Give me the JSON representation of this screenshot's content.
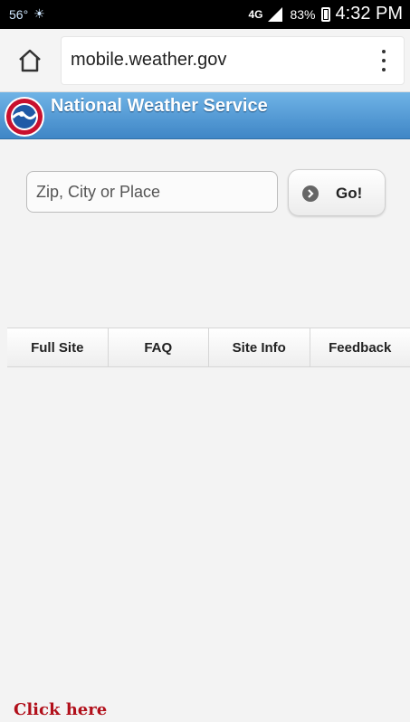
{
  "status_bar": {
    "temperature": "56°",
    "weather_glyph": "weather-sun-icon",
    "network": "4G",
    "battery": "83%",
    "time": "4:32 PM"
  },
  "browser": {
    "url": "mobile.weather.gov"
  },
  "nws": {
    "title": "National Weather Service",
    "logo": "nws-logo-icon"
  },
  "search": {
    "placeholder": "Zip, City or Place",
    "go_label": "Go!"
  },
  "nav": {
    "items": [
      {
        "label": "Full Site"
      },
      {
        "label": "FAQ"
      },
      {
        "label": "Site Info"
      },
      {
        "label": "Feedback"
      }
    ]
  },
  "footer": {
    "click_here": "Click here"
  },
  "colors": {
    "header_blue": "#3f86c6",
    "click_here_red": "#b10f1a"
  }
}
